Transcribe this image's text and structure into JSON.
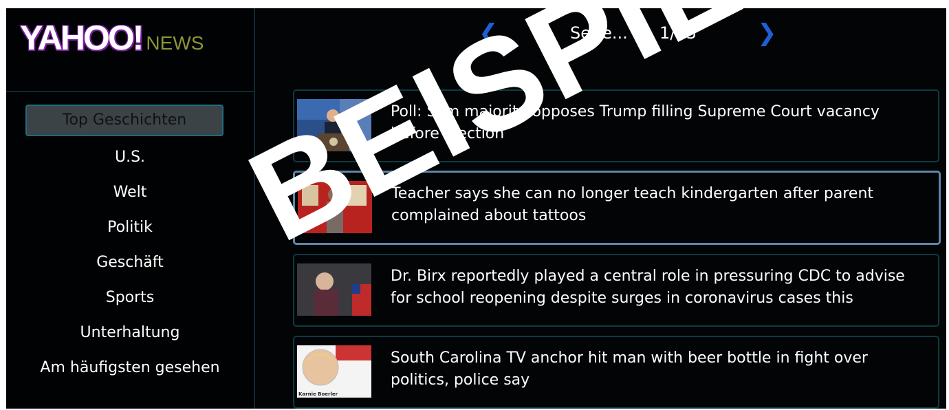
{
  "logo": {
    "brand": "YAHOO!",
    "section": "NEWS"
  },
  "pager": {
    "prev_icon": "chevron-left-icon",
    "label": "Seite...",
    "page": "1/13",
    "next_icon": "chevron-right-icon"
  },
  "nav": {
    "items": [
      {
        "label": "Top Geschichten",
        "active": true
      },
      {
        "label": "U.S."
      },
      {
        "label": "Welt"
      },
      {
        "label": "Politik"
      },
      {
        "label": "Geschäft"
      },
      {
        "label": "Sports"
      },
      {
        "label": "Unterhaltung"
      },
      {
        "label": "Am häufigsten gesehen"
      }
    ]
  },
  "articles": [
    {
      "headline": "Poll: Slim majority opposes Trump filling Supreme Court vacancy before election"
    },
    {
      "headline": "Teacher says she can no longer teach kindergarten after parent complained about tattoos",
      "selected": true
    },
    {
      "headline": "Dr. Birx reportedly played a central role in pressuring CDC to advise for school reopening despite surges in coronavirus cases this"
    },
    {
      "headline": "South Carolina TV anchor hit man with beer bottle in fight over politics, police say"
    }
  ],
  "thumb_caption": "Karnie Boerler",
  "watermark": "BEISPIEL",
  "colors": {
    "accent": "#1e5fd6",
    "selected_border": "#5f87a9",
    "card_border": "#0e3a44",
    "brand_purple": "#7b1fa2"
  }
}
